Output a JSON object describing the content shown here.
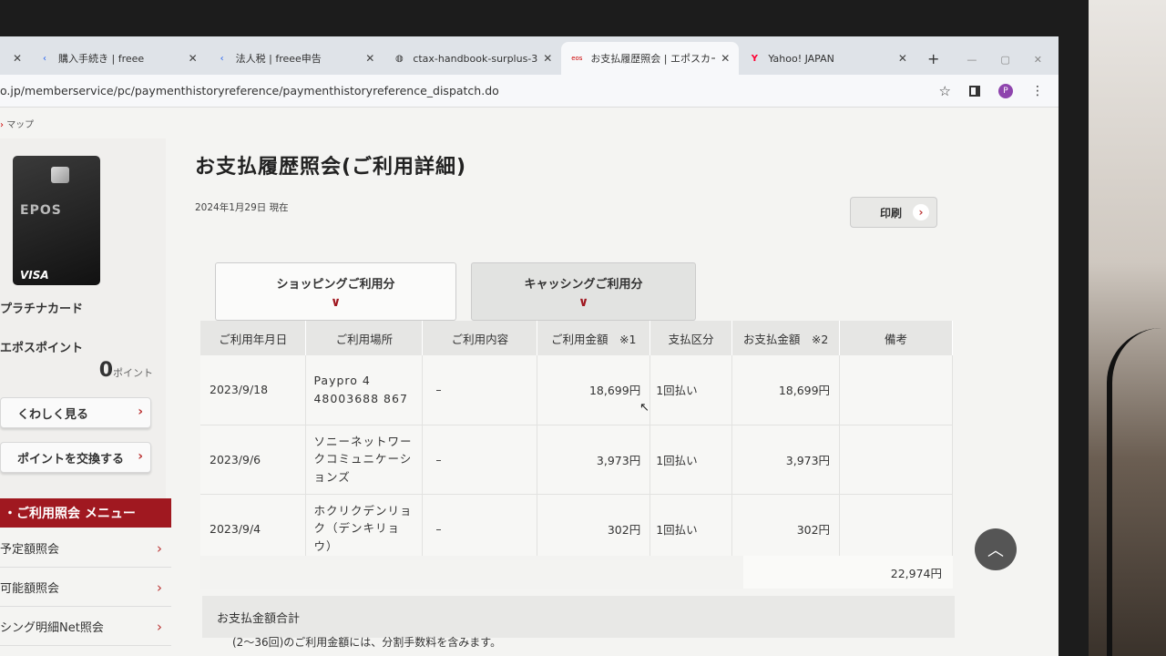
{
  "browser": {
    "tabs": [
      {
        "title": "購入手続き | freee",
        "icon": "freee-icon",
        "active": false
      },
      {
        "title": "法人税 | freee申告",
        "icon": "freee-icon",
        "active": false
      },
      {
        "title": "ctax-handbook-surplus-3",
        "icon": "globe-icon",
        "active": false
      },
      {
        "title": "お支払履歴照会 | エポスカー",
        "icon": "epos-icon",
        "active": true
      },
      {
        "title": "Yahoo! JAPAN",
        "icon": "yahoo-icon",
        "active": false
      }
    ],
    "new_tab": "+",
    "close": "✕",
    "url": "o.jp/memberservice/pc/paymenthistoryreference/paymenthistoryreference_dispatch.do",
    "profile_initial": "P"
  },
  "breadcrumb": {
    "text": "マップ"
  },
  "sidebar": {
    "card": {
      "logo": "EPOS",
      "brand": "VISA",
      "name": "プラチナカード"
    },
    "points": {
      "title": "エポスポイント",
      "value": "0",
      "unit": "ポイント"
    },
    "buttons": {
      "details": "くわしく見る",
      "exchange": "ポイントを交換する"
    },
    "menu": {
      "title": "・ご利用照会 メニュー",
      "items": [
        "予定額照会",
        "可能額照会",
        "シング明細Net照会"
      ]
    }
  },
  "main": {
    "title": "お支払履歴照会(ご利用詳細)",
    "as_of": "2024年1月29日 現在",
    "print": "印刷",
    "tabs": {
      "shopping": "ショッピングご利用分",
      "cashing": "キャッシングご利用分"
    },
    "table": {
      "headers": [
        "ご利用年月日",
        "ご利用場所",
        "ご利用内容",
        "ご利用金額　※1",
        "支払区分",
        "お支払金額　※2",
        "備考"
      ],
      "rows": [
        {
          "date": "2023/9/18",
          "place": "Paypro 4 48003688 867",
          "content": "–",
          "amount": "18,699円",
          "kubun": "1回払い",
          "pay": "18,699円",
          "note": ""
        },
        {
          "date": "2023/9/6",
          "place": "ソニーネットワークコミュニケーションズ",
          "content": "–",
          "amount": "3,973円",
          "kubun": "1回払い",
          "pay": "3,973円",
          "note": ""
        },
        {
          "date": "2023/9/4",
          "place": "ホクリクデンリョク（デンキリョウ）",
          "content": "–",
          "amount": "302円",
          "kubun": "1回払い",
          "pay": "302円",
          "note": ""
        }
      ],
      "total": "22,974円"
    },
    "sum_label": "お支払金額合計",
    "footnote": "(2～36回)のご利用金額には、分割手数料を含みます。"
  },
  "colors": {
    "brand": "#a01820",
    "chevron": "#b33333"
  }
}
